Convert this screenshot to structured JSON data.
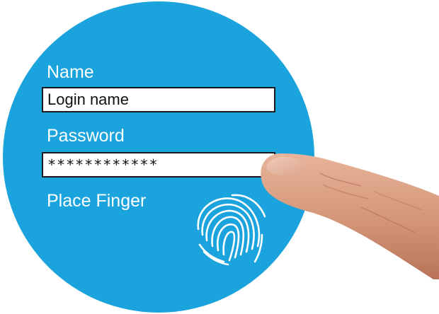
{
  "form": {
    "name_label": "Name",
    "name_value": "Login name",
    "password_label": "Password",
    "password_value": "************",
    "finger_label": "Place Finger"
  },
  "icons": {
    "fingerprint": "fingerprint-icon",
    "finger": "finger-illustration"
  },
  "colors": {
    "accent": "#1aa3dd",
    "field_background": "#ffffff",
    "field_border": "#1a1a1a",
    "label_text": "#ffffff",
    "skin": "#d99a7c"
  }
}
